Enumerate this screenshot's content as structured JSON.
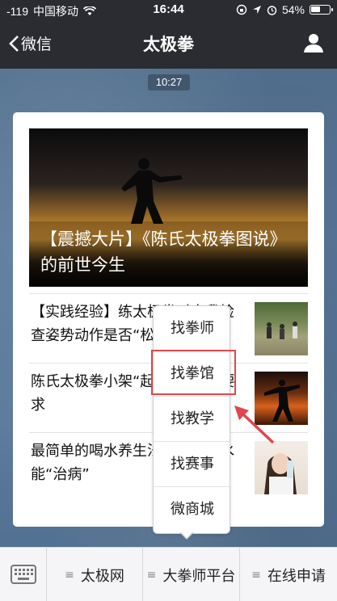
{
  "status_bar": {
    "signal": "-119",
    "carrier": "中国移动",
    "time": "16:44",
    "battery_percent": "54%",
    "battery_level": 0.54
  },
  "nav": {
    "back_label": "微信",
    "title": "太极拳",
    "profile_icon": "person-icon"
  },
  "chat": {
    "timestamp": "10:27"
  },
  "hero": {
    "caption": "【震撼大片】《陈氏太极拳图说》的前世今生"
  },
  "articles": [
    {
      "title": "【实践经验】练太极拳时自我检查姿势动作是否“松”到位了",
      "thumb": "thumb-practice-group"
    },
    {
      "title": "陈氏太极拳小架“起势”练法及要求",
      "thumb": "thumb-sunset-pose"
    },
    {
      "title": "最简单的喝水养生法：时刻喝水能“治病”",
      "thumb": "thumb-woman-drinking"
    }
  ],
  "popup_menu": {
    "items": [
      "找拳师",
      "找拳馆",
      "找教学",
      "找赛事",
      "微商城"
    ],
    "highlighted": "找拳馆"
  },
  "bottom_menu": {
    "keyboard_icon": "keyboard-icon",
    "tabs": [
      "太极网",
      "大拳师平台",
      "在线申请"
    ]
  },
  "colors": {
    "nav_bg": "#2a2c31",
    "highlight": "#e0464b"
  }
}
